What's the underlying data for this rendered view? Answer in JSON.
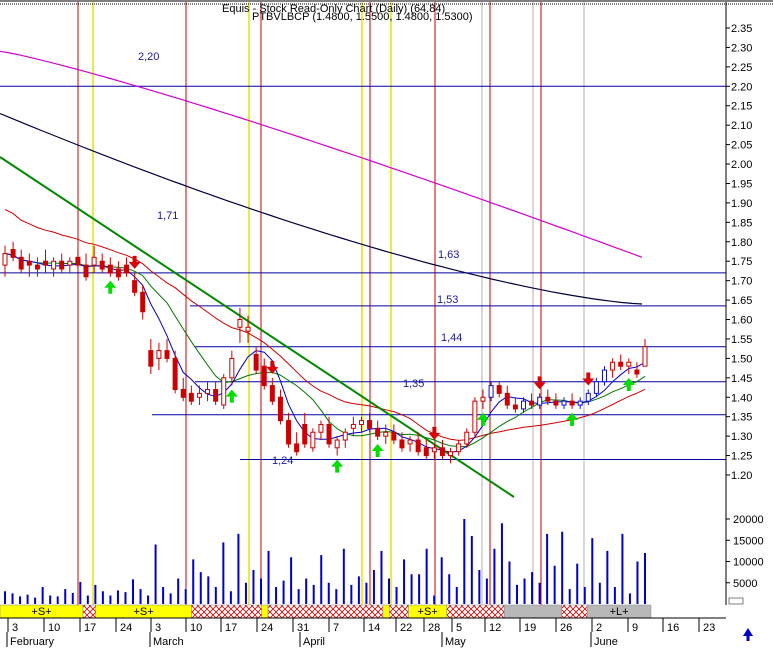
{
  "window": {
    "title_line1": "Equis - Stock Read-Only Chart (Daily) (64.84)",
    "title_line2": "PTBVLBCP (1.4800, 1.5500, 1.4800, 1.5300)"
  },
  "colors": {
    "background": "#ffffff",
    "price_up": "#ffffff",
    "price_down": "#cc0000",
    "candle_outline": "#cc0000",
    "blue_candle": "#1010cc",
    "ma_black": "#000040",
    "ma_magenta": "#d000d0",
    "ma_red": "#cc0000",
    "ma_dark_green": "#007700",
    "ma_blue": "#0000cc",
    "trendline": "#008800",
    "hline": "#0000a0",
    "vline_red": "#cc0000",
    "vline_yellow": "#e8e000",
    "vline_gray": "#b0b0b0",
    "volume": "#0000cc",
    "arrow_up": "#00dd00",
    "arrow_down": "#dd0000",
    "strip_yellow": "#ffff00",
    "strip_red": "#cc0000",
    "strip_gray": "#b8b8b8",
    "scroll_arrow": "#0000cc"
  },
  "chart_data": {
    "type": "candlestick",
    "title": "PTBVLBCP (1.4800, 1.5500, 1.4800, 1.5300)",
    "ohlc_last": {
      "open": 1.48,
      "high": 1.55,
      "low": 1.48,
      "close": 1.53
    },
    "price_axis": {
      "ylim": [
        1.18,
        2.4
      ],
      "ticks": [
        "2.35",
        "2.30",
        "2.25",
        "2.20",
        "2.15",
        "2.10",
        "2.05",
        "2.00",
        "1.95",
        "1.90",
        "1.85",
        "1.80",
        "1.75",
        "1.70",
        "1.65",
        "1.60",
        "1.55",
        "1.50",
        "1.45",
        "1.40",
        "1.35",
        "1.30",
        "1.25",
        "1.20"
      ]
    },
    "volume_axis": {
      "ylim": [
        0,
        22000
      ],
      "ticks": [
        "20000",
        "15000",
        "10000",
        "5000"
      ]
    },
    "x_axis": {
      "day_labels": [
        "3",
        "10",
        "17",
        "24",
        "3",
        "10",
        "17",
        "24",
        "31",
        "7",
        "14",
        "22",
        "28",
        "5",
        "12",
        "19",
        "26",
        "2",
        "9",
        "16",
        "23"
      ],
      "month_labels": [
        "February",
        "March",
        "April",
        "May",
        "June"
      ]
    },
    "horizontal_levels": [
      {
        "label": "2,20",
        "value": 2.2
      },
      {
        "label": "1,71",
        "value": 1.72
      },
      {
        "label": "1,63",
        "value": 1.635
      },
      {
        "label": "1,53",
        "value": 1.53
      },
      {
        "label": "1,44",
        "value": 1.44
      },
      {
        "label": "1,35",
        "value": 1.355
      },
      {
        "label": "1,24",
        "value": 1.24
      }
    ],
    "candles": [
      {
        "o": 1.74,
        "h": 1.79,
        "l": 1.71,
        "c": 1.77
      },
      {
        "o": 1.78,
        "h": 1.8,
        "l": 1.75,
        "c": 1.76
      },
      {
        "o": 1.76,
        "h": 1.78,
        "l": 1.72,
        "c": 1.73
      },
      {
        "o": 1.75,
        "h": 1.77,
        "l": 1.71,
        "c": 1.74
      },
      {
        "o": 1.74,
        "h": 1.76,
        "l": 1.71,
        "c": 1.73
      },
      {
        "o": 1.75,
        "h": 1.78,
        "l": 1.72,
        "c": 1.74
      },
      {
        "o": 1.73,
        "h": 1.76,
        "l": 1.71,
        "c": 1.75
      },
      {
        "o": 1.75,
        "h": 1.77,
        "l": 1.72,
        "c": 1.73
      },
      {
        "o": 1.74,
        "h": 1.76,
        "l": 1.72,
        "c": 1.75
      },
      {
        "o": 1.76,
        "h": 1.78,
        "l": 1.73,
        "c": 1.74
      },
      {
        "o": 1.74,
        "h": 1.77,
        "l": 1.7,
        "c": 1.71
      },
      {
        "o": 1.74,
        "h": 1.79,
        "l": 1.72,
        "c": 1.76
      },
      {
        "o": 1.75,
        "h": 1.77,
        "l": 1.72,
        "c": 1.73
      },
      {
        "o": 1.74,
        "h": 1.76,
        "l": 1.71,
        "c": 1.72
      },
      {
        "o": 1.73,
        "h": 1.75,
        "l": 1.7,
        "c": 1.71
      },
      {
        "o": 1.74,
        "h": 1.76,
        "l": 1.71,
        "c": 1.72
      },
      {
        "o": 1.7,
        "h": 1.72,
        "l": 1.66,
        "c": 1.67
      },
      {
        "o": 1.67,
        "h": 1.69,
        "l": 1.6,
        "c": 1.62
      },
      {
        "o": 1.52,
        "h": 1.55,
        "l": 1.46,
        "c": 1.48
      },
      {
        "o": 1.5,
        "h": 1.54,
        "l": 1.47,
        "c": 1.52
      },
      {
        "o": 1.52,
        "h": 1.55,
        "l": 1.49,
        "c": 1.5
      },
      {
        "o": 1.5,
        "h": 1.52,
        "l": 1.41,
        "c": 1.42
      },
      {
        "o": 1.42,
        "h": 1.45,
        "l": 1.39,
        "c": 1.4
      },
      {
        "o": 1.41,
        "h": 1.43,
        "l": 1.38,
        "c": 1.39
      },
      {
        "o": 1.4,
        "h": 1.43,
        "l": 1.38,
        "c": 1.41
      },
      {
        "o": 1.41,
        "h": 1.44,
        "l": 1.39,
        "c": 1.42
      },
      {
        "o": 1.42,
        "h": 1.44,
        "l": 1.38,
        "c": 1.39
      },
      {
        "o": 1.38,
        "h": 1.46,
        "l": 1.37,
        "c": 1.45
      },
      {
        "o": 1.45,
        "h": 1.52,
        "l": 1.43,
        "c": 1.5
      },
      {
        "o": 1.58,
        "h": 1.63,
        "l": 1.54,
        "c": 1.6
      },
      {
        "o": 1.57,
        "h": 1.61,
        "l": 1.54,
        "c": 1.58
      },
      {
        "o": 1.51,
        "h": 1.53,
        "l": 1.46,
        "c": 1.47
      },
      {
        "o": 1.48,
        "h": 1.5,
        "l": 1.42,
        "c": 1.43
      },
      {
        "o": 1.43,
        "h": 1.45,
        "l": 1.38,
        "c": 1.39
      },
      {
        "o": 1.4,
        "h": 1.42,
        "l": 1.33,
        "c": 1.34
      },
      {
        "o": 1.34,
        "h": 1.36,
        "l": 1.27,
        "c": 1.28
      },
      {
        "o": 1.28,
        "h": 1.31,
        "l": 1.25,
        "c": 1.26
      },
      {
        "o": 1.33,
        "h": 1.36,
        "l": 1.27,
        "c": 1.28
      },
      {
        "o": 1.27,
        "h": 1.32,
        "l": 1.26,
        "c": 1.31
      },
      {
        "o": 1.31,
        "h": 1.34,
        "l": 1.29,
        "c": 1.33
      },
      {
        "o": 1.33,
        "h": 1.35,
        "l": 1.27,
        "c": 1.28
      },
      {
        "o": 1.27,
        "h": 1.3,
        "l": 1.25,
        "c": 1.29
      },
      {
        "o": 1.29,
        "h": 1.32,
        "l": 1.27,
        "c": 1.31
      },
      {
        "o": 1.32,
        "h": 1.35,
        "l": 1.3,
        "c": 1.33
      },
      {
        "o": 1.33,
        "h": 1.35,
        "l": 1.31,
        "c": 1.34
      },
      {
        "o": 1.34,
        "h": 1.36,
        "l": 1.31,
        "c": 1.32
      },
      {
        "o": 1.32,
        "h": 1.34,
        "l": 1.29,
        "c": 1.3
      },
      {
        "o": 1.3,
        "h": 1.33,
        "l": 1.28,
        "c": 1.31
      },
      {
        "o": 1.31,
        "h": 1.33,
        "l": 1.28,
        "c": 1.29
      },
      {
        "o": 1.29,
        "h": 1.31,
        "l": 1.26,
        "c": 1.27
      },
      {
        "o": 1.28,
        "h": 1.3,
        "l": 1.26,
        "c": 1.29
      },
      {
        "o": 1.29,
        "h": 1.31,
        "l": 1.25,
        "c": 1.26
      },
      {
        "o": 1.27,
        "h": 1.29,
        "l": 1.24,
        "c": 1.25
      },
      {
        "o": 1.26,
        "h": 1.28,
        "l": 1.24,
        "c": 1.27
      },
      {
        "o": 1.27,
        "h": 1.29,
        "l": 1.24,
        "c": 1.25
      },
      {
        "o": 1.25,
        "h": 1.27,
        "l": 1.23,
        "c": 1.26
      },
      {
        "o": 1.26,
        "h": 1.29,
        "l": 1.25,
        "c": 1.28
      },
      {
        "o": 1.28,
        "h": 1.32,
        "l": 1.27,
        "c": 1.31
      },
      {
        "o": 1.31,
        "h": 1.4,
        "l": 1.3,
        "c": 1.39
      },
      {
        "o": 1.39,
        "h": 1.42,
        "l": 1.37,
        "c": 1.4
      },
      {
        "o": 1.4,
        "h": 1.44,
        "l": 1.39,
        "c": 1.43
      },
      {
        "o": 1.43,
        "h": 1.44,
        "l": 1.4,
        "c": 1.41
      },
      {
        "o": 1.41,
        "h": 1.43,
        "l": 1.37,
        "c": 1.38
      },
      {
        "o": 1.38,
        "h": 1.4,
        "l": 1.36,
        "c": 1.37
      },
      {
        "o": 1.37,
        "h": 1.4,
        "l": 1.36,
        "c": 1.39
      },
      {
        "o": 1.39,
        "h": 1.41,
        "l": 1.37,
        "c": 1.38
      },
      {
        "o": 1.38,
        "h": 1.41,
        "l": 1.37,
        "c": 1.4
      },
      {
        "o": 1.4,
        "h": 1.42,
        "l": 1.38,
        "c": 1.39
      },
      {
        "o": 1.39,
        "h": 1.41,
        "l": 1.37,
        "c": 1.38
      },
      {
        "o": 1.38,
        "h": 1.4,
        "l": 1.37,
        "c": 1.39
      },
      {
        "o": 1.39,
        "h": 1.41,
        "l": 1.37,
        "c": 1.38
      },
      {
        "o": 1.38,
        "h": 1.4,
        "l": 1.37,
        "c": 1.39
      },
      {
        "o": 1.39,
        "h": 1.42,
        "l": 1.38,
        "c": 1.41
      },
      {
        "o": 1.41,
        "h": 1.45,
        "l": 1.4,
        "c": 1.44
      },
      {
        "o": 1.44,
        "h": 1.48,
        "l": 1.43,
        "c": 1.47
      },
      {
        "o": 1.47,
        "h": 1.5,
        "l": 1.45,
        "c": 1.49
      },
      {
        "o": 1.49,
        "h": 1.51,
        "l": 1.47,
        "c": 1.48
      },
      {
        "o": 1.48,
        "h": 1.5,
        "l": 1.46,
        "c": 1.49
      },
      {
        "o": 1.47,
        "h": 1.49,
        "l": 1.45,
        "c": 1.46
      },
      {
        "o": 1.48,
        "h": 1.55,
        "l": 1.48,
        "c": 1.53
      }
    ],
    "volume": [
      3000,
      2500,
      1800,
      2200,
      1500,
      4000,
      2000,
      1800,
      3500,
      2600,
      5200,
      2000,
      4500,
      3000,
      2000,
      3200,
      2800,
      5800,
      3500,
      2000,
      14000,
      4000,
      2500,
      6000,
      3500,
      10500,
      7500,
      6500,
      4000,
      14500,
      3000,
      16500,
      5000,
      8000,
      6000,
      12500,
      4000,
      5500,
      11000,
      3500,
      6000,
      4500,
      11500,
      5000,
      3500,
      13000,
      4500,
      6500,
      5000,
      8000,
      12500,
      6000,
      4000,
      10500,
      7000,
      7000,
      13000,
      2000,
      11000,
      7000,
      4000,
      20000,
      16000,
      8000,
      6000,
      13000,
      19000,
      10000,
      4500,
      6000,
      7500,
      5000,
      16500,
      9000,
      17000,
      3500,
      9500,
      4000,
      15500,
      5000,
      12500,
      4000,
      16500,
      2500,
      10000,
      12000
    ],
    "overlays": [
      {
        "type": "moving-average",
        "color": "magenta"
      },
      {
        "type": "moving-average",
        "color": "black"
      },
      {
        "type": "moving-average",
        "color": "red"
      },
      {
        "type": "moving-average",
        "color": "green"
      },
      {
        "type": "moving-average",
        "color": "blue"
      },
      {
        "type": "trendline",
        "color": "green"
      }
    ],
    "signals": [
      {
        "type": "up",
        "index": 13
      },
      {
        "type": "down",
        "index": 16
      },
      {
        "type": "up",
        "index": 28
      },
      {
        "type": "down",
        "index": 33
      },
      {
        "type": "up",
        "index": 41
      },
      {
        "type": "up",
        "index": 46
      },
      {
        "type": "down",
        "index": 53
      },
      {
        "type": "up",
        "index": 59
      },
      {
        "type": "down",
        "index": 66
      },
      {
        "type": "up",
        "index": 70
      },
      {
        "type": "down",
        "index": 72
      },
      {
        "type": "up",
        "index": 77
      }
    ],
    "signal_strip": [
      {
        "label": "+S+",
        "color": "yellow",
        "from": 0,
        "to": 13
      },
      {
        "label": "",
        "color": "red",
        "from": 13,
        "to": 15
      },
      {
        "label": "+S+",
        "color": "yellow",
        "from": 15,
        "to": 30
      },
      {
        "label": "",
        "color": "red",
        "from": 30,
        "to": 41
      },
      {
        "label": "",
        "color": "yellow",
        "from": 41,
        "to": 42
      },
      {
        "label": "",
        "color": "red",
        "from": 42,
        "to": 60
      },
      {
        "label": "",
        "color": "yellow",
        "from": 60,
        "to": 61
      },
      {
        "label": "",
        "color": "red",
        "from": 61,
        "to": 64
      },
      {
        "label": "+S+",
        "color": "yellow",
        "from": 64,
        "to": 70
      },
      {
        "label": "",
        "color": "red",
        "from": 70,
        "to": 79
      },
      {
        "label": "",
        "color": "gray",
        "from": 79,
        "to": 88
      },
      {
        "label": "",
        "color": "red",
        "from": 88,
        "to": 92
      },
      {
        "label": "+L+",
        "color": "gray",
        "from": 92,
        "to": 102
      }
    ]
  }
}
